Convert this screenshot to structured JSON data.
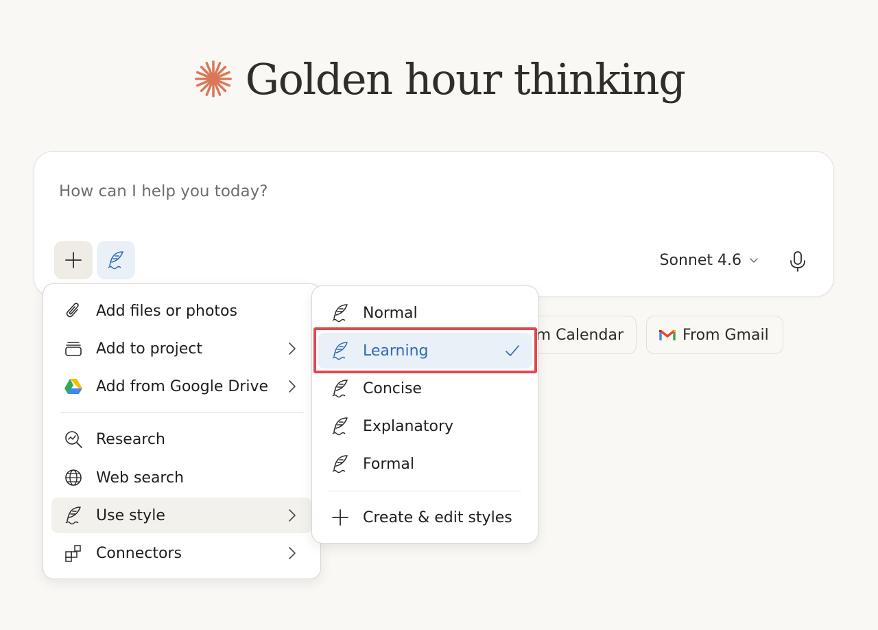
{
  "greeting": {
    "title": "Golden hour thinking",
    "icon": "sparkle-icon",
    "icon_color": "#d97757"
  },
  "composer": {
    "placeholder": "How can I help you today?",
    "value": "",
    "model": "Sonnet 4.6"
  },
  "chips": {
    "calendar_label": "m Calendar",
    "gmail_label": "From Gmail"
  },
  "attach_menu": {
    "items": [
      {
        "label": "Add files or photos",
        "icon": "paperclip-icon"
      },
      {
        "label": "Add to project",
        "icon": "project-stack-icon"
      },
      {
        "label": "Add from Google Drive",
        "icon": "google-drive-icon"
      },
      {
        "label": "Research",
        "icon": "research-icon"
      },
      {
        "label": "Web search",
        "icon": "globe-icon"
      },
      {
        "label": "Use style",
        "icon": "quill-icon"
      },
      {
        "label": "Connectors",
        "icon": "connectors-icon"
      }
    ]
  },
  "style_menu": {
    "items": [
      {
        "label": "Normal",
        "icon": "quill-icon"
      },
      {
        "label": "Learning",
        "icon": "quill-icon",
        "selected": true
      },
      {
        "label": "Concise",
        "icon": "quill-icon"
      },
      {
        "label": "Explanatory",
        "icon": "quill-icon"
      },
      {
        "label": "Formal",
        "icon": "quill-icon"
      }
    ],
    "create_label": "Create & edit styles"
  },
  "colors": {
    "accent_blue": "#2d6bb5",
    "highlight_red": "#e1474f",
    "background": "#f9f8f5"
  }
}
